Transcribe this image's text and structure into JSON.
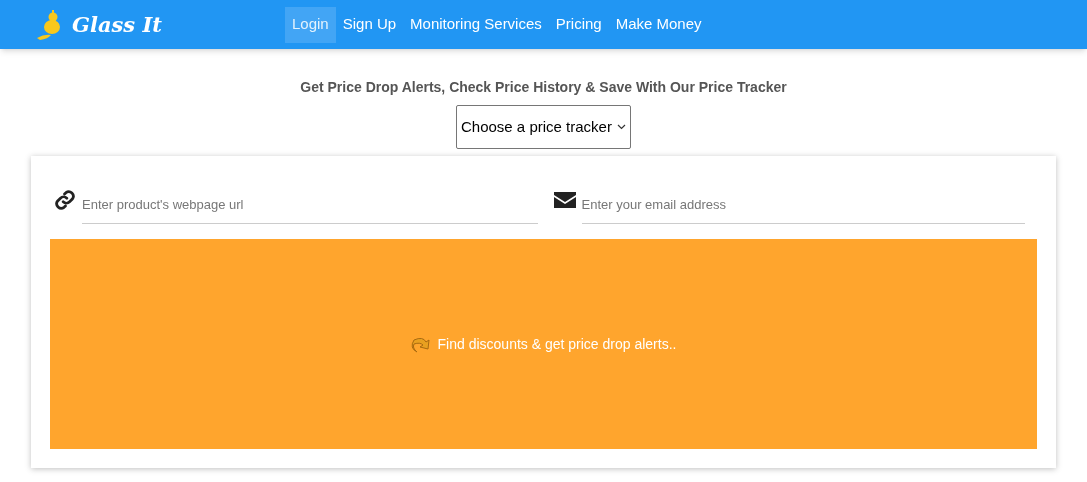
{
  "navbar": {
    "logo_text": "Glass It",
    "links": [
      {
        "label": "Login",
        "selected": true
      },
      {
        "label": "Sign Up",
        "selected": false
      },
      {
        "label": "Monitoring Services",
        "selected": false
      },
      {
        "label": "Pricing",
        "selected": false
      },
      {
        "label": "Make Money",
        "selected": false
      }
    ]
  },
  "heading": "Get Price Drop Alerts, Check Price History & Save With Our Price Tracker",
  "tracker_select": {
    "value": "Choose a price tracker"
  },
  "form": {
    "url_field": {
      "placeholder": "Enter product's webpage url"
    },
    "email_field": {
      "placeholder": "Enter your email address"
    },
    "submit_button": "Find discounts & get price drop alerts.."
  }
}
